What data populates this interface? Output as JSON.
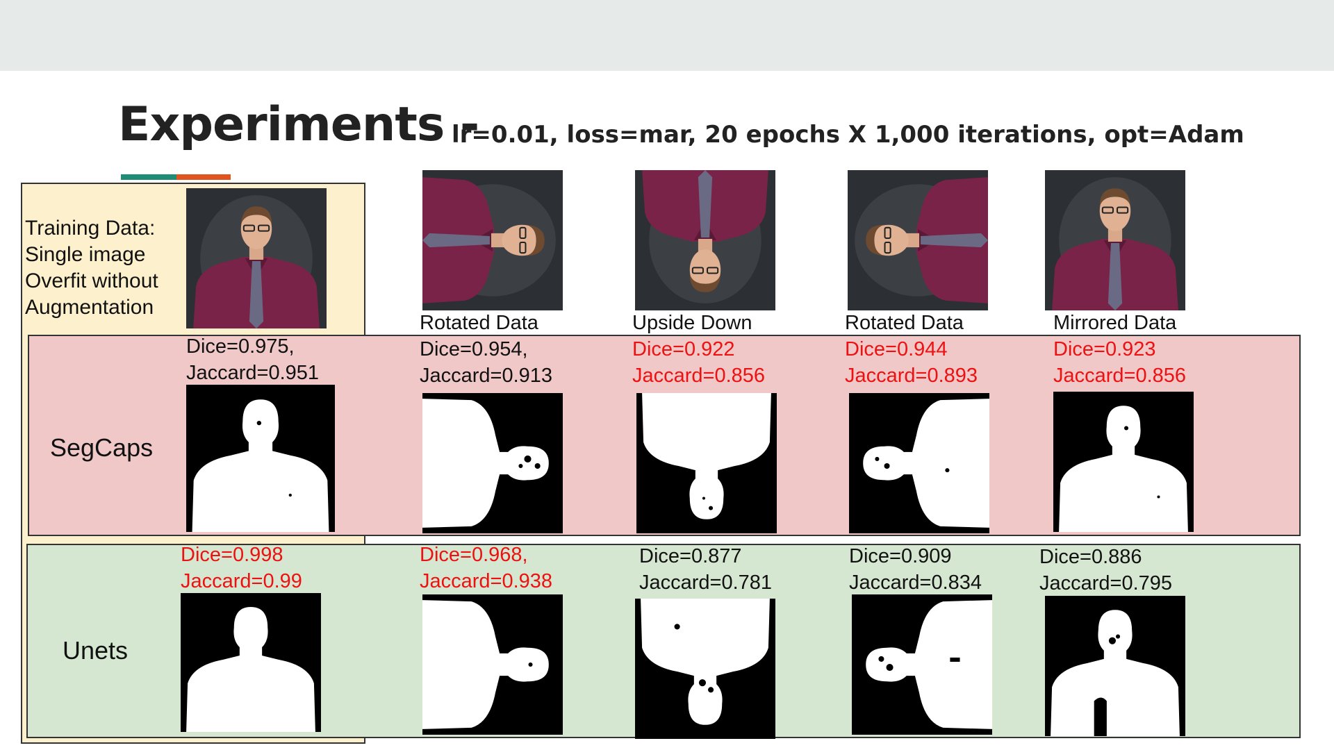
{
  "slide": {
    "title": "Experiments -",
    "subtitle": "lr=0.01, loss=mar, 20 epochs X 1,000 iterations, opt=Adam",
    "colors": {
      "accent_teal": "#1f8c78",
      "accent_orange": "#e0541e",
      "segcaps_band": "#f0c8c8",
      "unets_band": "#d5e7d0",
      "training_panel": "#fdf0cc",
      "highlight_red": "#ee1111"
    }
  },
  "training": {
    "lines": [
      "Training Data:",
      "Single image",
      "Overfit without",
      "Augmentation"
    ]
  },
  "rows": {
    "segcaps": "SegCaps",
    "unets": "Unets"
  },
  "columns": [
    {
      "header": "",
      "segcaps": {
        "dice": "Dice=0.975,",
        "jaccard": "Jaccard=0.951",
        "highlight": false
      },
      "unets": {
        "dice": "Dice=0.998",
        "jaccard": "Jaccard=0.99",
        "highlight": true
      }
    },
    {
      "header": "Rotated Data",
      "segcaps": {
        "dice": "Dice=0.954,",
        "jaccard": "Jaccard=0.913",
        "highlight": false
      },
      "unets": {
        "dice": "Dice=0.968,",
        "jaccard": "Jaccard=0.938",
        "highlight": true
      }
    },
    {
      "header": "Upside Down",
      "segcaps": {
        "dice": "Dice=0.922",
        "jaccard": "Jaccard=0.856",
        "highlight": true
      },
      "unets": {
        "dice": "Dice=0.877",
        "jaccard": "Jaccard=0.781",
        "highlight": false
      }
    },
    {
      "header": "Rotated Data",
      "segcaps": {
        "dice": "Dice=0.944",
        "jaccard": "Jaccard=0.893",
        "highlight": true
      },
      "unets": {
        "dice": "Dice=0.909",
        "jaccard": "Jaccard=0.834",
        "highlight": false
      }
    },
    {
      "header": "Mirrored Data",
      "segcaps": {
        "dice": "Dice=0.923",
        "jaccard": "Jaccard=0.856",
        "highlight": true
      },
      "unets": {
        "dice": "Dice=0.886",
        "jaccard": "Jaccard=0.795",
        "highlight": false
      }
    }
  ]
}
